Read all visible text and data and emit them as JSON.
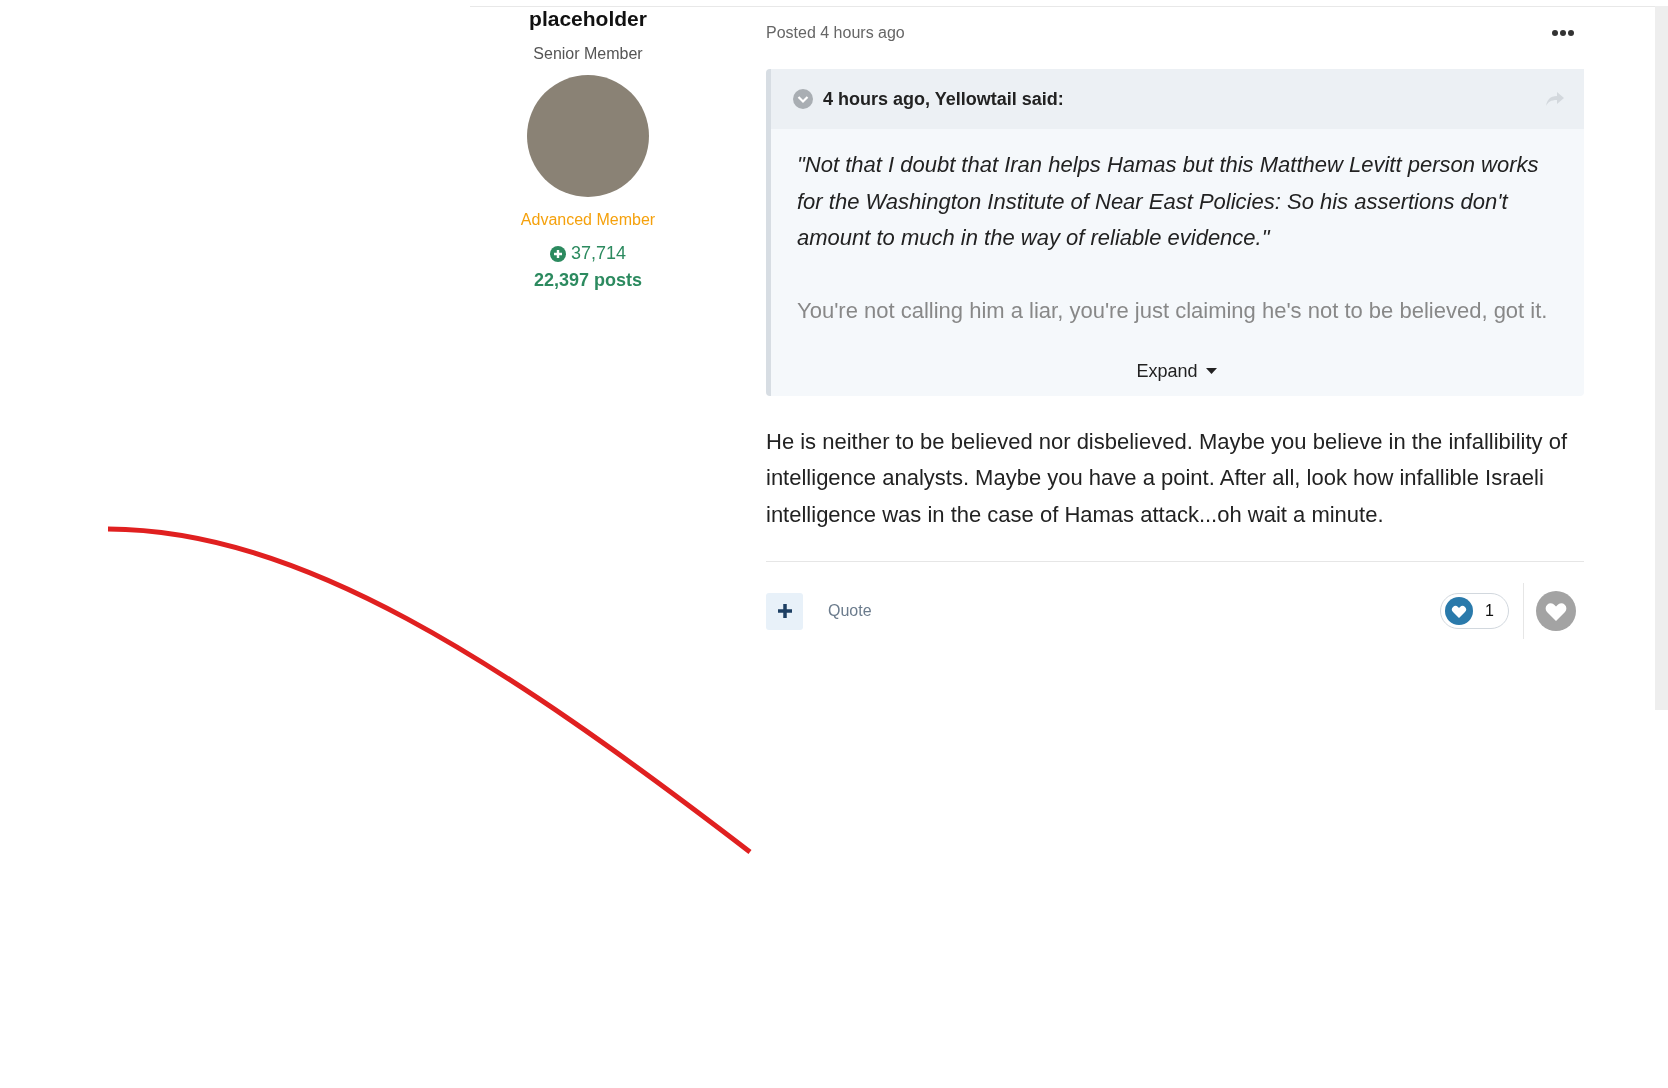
{
  "author": {
    "name": "placeholder",
    "title": "Senior Member",
    "rank": "Advanced Member",
    "reputation": "37,714",
    "posts": "22,397 posts"
  },
  "post": {
    "meta": "Posted 4 hours ago",
    "quote": {
      "header": "4 hours ago, Yellowtail said:",
      "quoted_text": "\"Not that I doubt that Iran helps Hamas but this Matthew Levitt person works for the Washington Institute of Near East Policies: So his assertions don't amount to much in the way of reliable evidence.\"",
      "reply_text": "You're not calling him a liar, you're just claiming he's not to be believed, got it.",
      "expand_label": "Expand"
    },
    "body": "He is neither to be believed nor disbelieved.  Maybe you believe in the infallibility of intelligence analysts. Maybe you have a point. After all, look how infallible Israeli intelligence was in the case of Hamas attack...oh wait a minute.",
    "footer": {
      "quote_label": "Quote",
      "reaction_count": "1"
    }
  }
}
